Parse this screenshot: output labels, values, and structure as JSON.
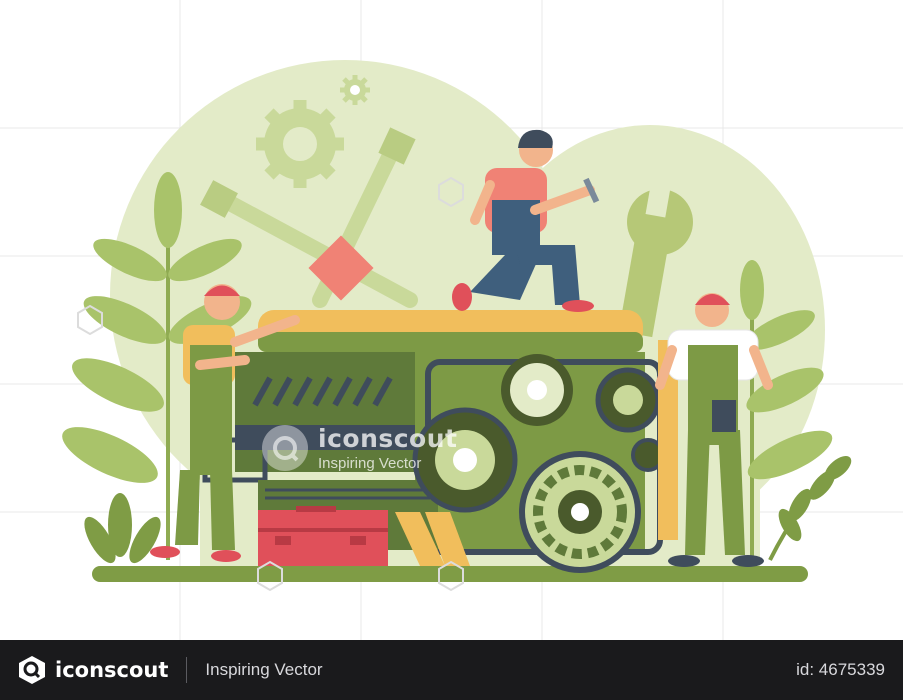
{
  "watermark": {
    "brand": "iconscout",
    "tagline": "Inspiring Vector"
  },
  "footer": {
    "brand": "iconscout",
    "tagline": "Inspiring Vector",
    "asset_id": "id: 4675339"
  },
  "icons": {
    "logo": "iconscout-logo-icon",
    "watermark": "iconscout-watermark-icon"
  },
  "palette": {
    "background": "#ffffff",
    "backdrop": "#e3ebc8",
    "leaf": "#b6c877",
    "dark_green": "#5f7a3a",
    "olive": "#7d9a45",
    "mustard": "#f1be5c",
    "engine_dark": "#3f4c5c",
    "toolbox_red": "#e0505a",
    "skin": "#f2b48c",
    "footer": "#1a1a1c"
  }
}
